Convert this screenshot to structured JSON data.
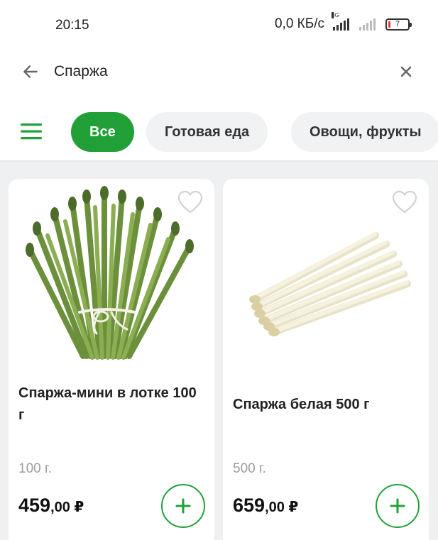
{
  "status_bar": {
    "time": "20:15",
    "net_speed": "0,0 КБ/с",
    "network_type": "4G",
    "battery_level": "7"
  },
  "search": {
    "query": "Спаржа",
    "back_icon": "arrow-left-icon",
    "clear_icon": "close-icon"
  },
  "categories": {
    "menu_icon": "hamburger-menu-icon",
    "chips": [
      {
        "label": "Все",
        "active": true
      },
      {
        "label": "Готовая еда",
        "active": false
      },
      {
        "label": "Овощи, фрукты",
        "active": false
      }
    ]
  },
  "products": [
    {
      "name": "Спаржа-мини в лотке 100 г",
      "weight": "100 г.",
      "price_int": "459",
      "price_dec": ",00 ₽",
      "image": "green-asparagus-bundle"
    },
    {
      "name": "Спаржа белая 500 г",
      "weight": "500 г.",
      "price_int": "659",
      "price_dec": ",00 ₽",
      "image": "white-asparagus"
    }
  ],
  "colors": {
    "accent": "#21a038",
    "chip_bg": "#f1f2f4",
    "content_bg": "#eef0f2",
    "muted_text": "#9a9da1"
  }
}
